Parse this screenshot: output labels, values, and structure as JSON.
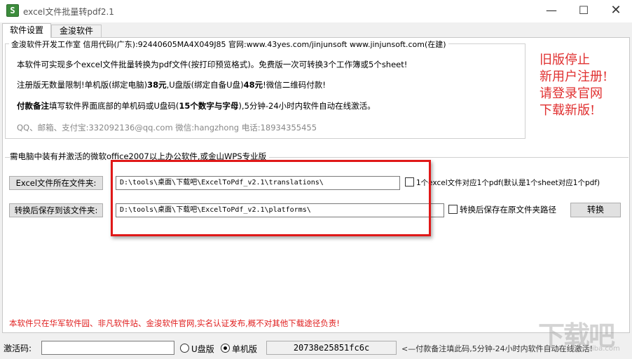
{
  "window": {
    "title": "excel文件批量转pdf2.1",
    "icon": "app-logo",
    "minimize": "—",
    "maximize": "☐",
    "close": "✕"
  },
  "tabs": [
    {
      "label": "软件设置",
      "active": true
    },
    {
      "label": "金浚软件",
      "active": false
    }
  ],
  "info": {
    "legend": "金浚软件开发工作室 信用代码(广东):92440605MA4X049J85 官网:www.43yes.com/jinjunsoft  www.jinjunsoft.com(在建)",
    "line1": "本软件可实现多个excel文件批量转换为pdf文件(按打印预览格式)。免费版一次可转换3个工作簿或5个sheet!",
    "line2_pre": "注册版无数量限制!单机版(绑定电脑)",
    "line2_price1": "38元",
    "line2_mid": ",U盘版(绑定自备U盘)",
    "line2_price2": "48元",
    "line2_post": "!微信二维码付款!",
    "line3_bold": "付款备注",
    "line3_mid": "填写软件界面底部的单机码或U盘码(",
    "line3_bold2": "15个数字与字母",
    "line3_post": "),5分钟-24小时内软件自动在线激活。",
    "contact": "QQ、邮箱、支付宝:332092136@qq.com  微信:hangzhong  电话:18934355455"
  },
  "red_notice": [
    "旧版停止",
    "新用户注册!",
    "请登录官网",
    "下载新版!"
  ],
  "requirement": "需电脑中装有并激活的微软office2007以上办公软件,或金山WPS专业版",
  "source": {
    "button_label": "Excel文件所在文件夹:",
    "path": "D:\\tools\\桌面\\下载吧\\ExcelToPdf_v2.1\\translations\\",
    "checkbox_label": "1个excel文件对应1个pdf(默认是1个sheet对应1个pdf)",
    "checked": false
  },
  "destination": {
    "button_label": "转换后保存到该文件夹:",
    "path": "D:\\tools\\桌面\\下载吧\\ExcelToPdf_v2.1\\platforms\\",
    "checkbox_label": "转换后保存在原文件夹路径",
    "checked": false
  },
  "convert_button": "转换",
  "bottom_notice": "本软件只在华军软件园、非凡软件站、金浚软件官网,实名认证发布,概不对其他下载途径负责!",
  "activation": {
    "label": "激活码:",
    "value": "",
    "radio_usb": "U盘版",
    "radio_machine": "单机版",
    "selected": "machine",
    "machine_code": "20738e25851fc6c",
    "hint": "<—付款备注填此码,5分钟-24小时内软件自动在线激活!"
  },
  "watermark": {
    "text": "下载吧",
    "sub": "www.xiazaiba.com"
  },
  "colors": {
    "notice_red": "#e03030",
    "highlight_red": "#e01818"
  }
}
